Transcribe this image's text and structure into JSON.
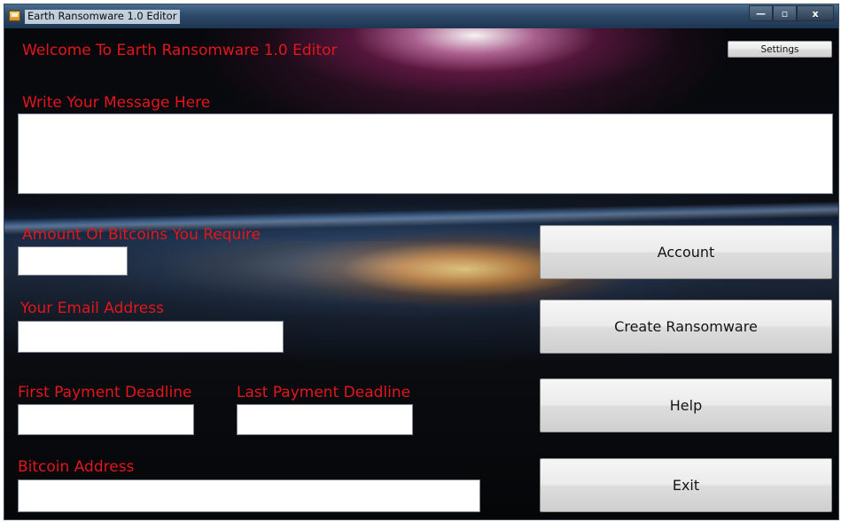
{
  "window": {
    "title": "Earth Ransomware 1.0 Editor",
    "caption_buttons": {
      "minimize": "—",
      "maximize": "▫",
      "close": "x"
    },
    "title_icon": "app-icon"
  },
  "main": {
    "welcome": "Welcome To Earth Ransomware 1.0 Editor",
    "settings_label": "Settings",
    "message_label": "Write Your Message Here",
    "message_value": "",
    "bitcoin_amount_label": "Amount Of Bitcoins You Require",
    "bitcoin_amount_value": "",
    "email_label": "Your Email Address",
    "email_value": "",
    "first_deadline_label": "First Payment Deadline",
    "first_deadline_value": "",
    "last_deadline_label": "Last Payment Deadline",
    "last_deadline_value": "",
    "bitcoin_address_label": "Bitcoin Address",
    "bitcoin_address_value": ""
  },
  "buttons": {
    "account": "Account",
    "create": "Create Ransomware",
    "help": "Help",
    "exit": "Exit"
  },
  "colors": {
    "label_red": "#e3161c",
    "background": "#0b0c12"
  }
}
